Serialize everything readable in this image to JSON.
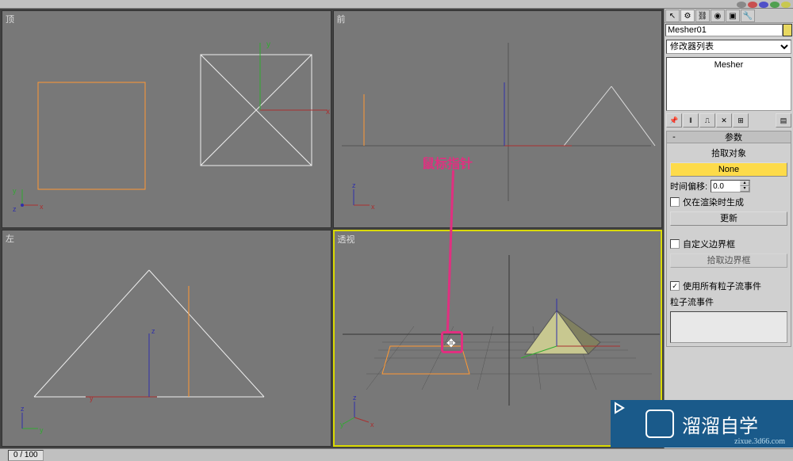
{
  "toolbar": {
    "visible": true
  },
  "viewports": {
    "top": {
      "label": "顶"
    },
    "front": {
      "label": "前"
    },
    "left": {
      "label": "左"
    },
    "perspective": {
      "label": "透视"
    }
  },
  "rightPanel": {
    "objectName": "Mesher01",
    "modifierDropdown": "修改器列表",
    "stack": {
      "item": "Mesher"
    },
    "rollouts": {
      "params": {
        "title": "参数",
        "pickObject": {
          "label": "拾取对象",
          "value": "None"
        },
        "timeOffset": {
          "label": "时间偏移:",
          "value": "0.0"
        },
        "renderOnly": {
          "label": "仅在渲染时生成",
          "checked": false
        },
        "update": "更新",
        "customBBox": {
          "label": "自定义边界框",
          "checked": false
        },
        "pickBBox": "拾取边界框",
        "useAllPF": {
          "label": "使用所有粒子流事件",
          "checked": true
        },
        "pfEvents": "粒子流事件"
      }
    }
  },
  "timeline": {
    "current": "0",
    "total": "100"
  },
  "annotation": {
    "text": "鼠标指针"
  },
  "watermark": {
    "text": "溜溜自学",
    "url": "zixue.3d66.com"
  },
  "axes": {
    "x": "x",
    "y": "y",
    "z": "z"
  }
}
